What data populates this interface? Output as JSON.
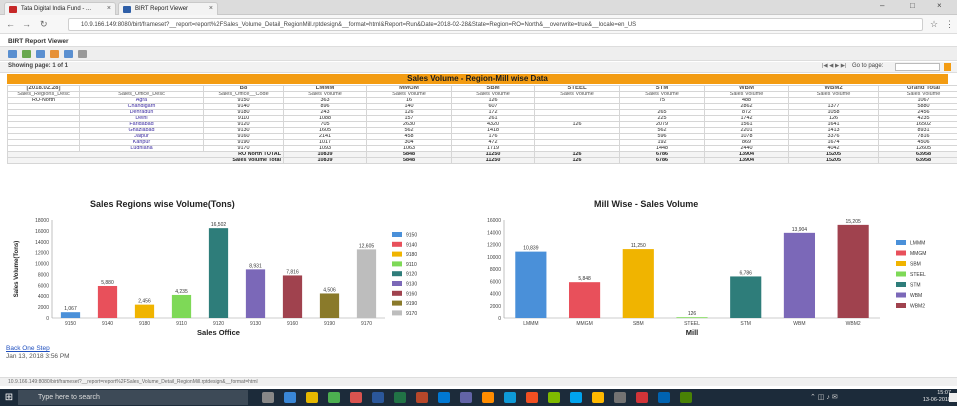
{
  "browser": {
    "tabs": [
      {
        "label": "Tata Digital India Fund - ..."
      },
      {
        "label": "BIRT Report Viewer"
      }
    ],
    "url": "10.9.166.149:8080/birt/frameset?__report=report%2FSales_Volume_Detail_RegionMill.rptdesign&__format=html&Report=Run&Date=2018-02-28&State=Region=RO=North&__overwrite=true&__locale=en_US"
  },
  "app": {
    "title": "BIRT Report Viewer",
    "pager": "Showing page: 1 of 1",
    "goto": "Go to page:"
  },
  "report": {
    "title": "Sales Volume - Region-Mill wise Data",
    "headers": [
      "[2018.02.28]",
      "",
      "",
      "B8",
      "LMMM",
      "MMGM",
      "SBM",
      "STEEL",
      "STM",
      "WBM",
      "WBM2",
      "Grand Total"
    ],
    "subheaders": [
      "Sales_Regions_Desc",
      "Sales_Office_Desc",
      "Sales_Office__Code",
      "Sales Volume",
      "Sales Volume",
      "Sales Volume",
      "Sales Volume",
      "Sales Volume",
      "Sales Volume",
      "Sales Volume",
      "Sales Volume"
    ],
    "rows": [
      [
        "RO-North",
        "Agra",
        "9150",
        "363",
        "16",
        "126",
        "",
        "75",
        "488",
        "",
        "1067"
      ],
      [
        "",
        "Chandigarh",
        "9140",
        "896",
        "140",
        "607",
        "",
        "",
        "2862",
        "1377",
        "5880"
      ],
      [
        "",
        "Dehradun",
        "9180",
        "243",
        "126",
        "172",
        "",
        "265",
        "872",
        "1058",
        "2456"
      ],
      [
        "",
        "Delhi",
        "9110",
        "1088",
        "157",
        "261",
        "",
        "225",
        "1742",
        "126",
        "4235"
      ],
      [
        "",
        "Faridabad",
        "9120",
        "705",
        "2630",
        "4320",
        "126",
        "2079",
        "1561",
        "1641",
        "16502"
      ],
      [
        "",
        "Ghaziabad",
        "9130",
        "1605",
        "562",
        "1418",
        "",
        "562",
        "2201",
        "1413",
        "8931"
      ],
      [
        "",
        "Jaipur",
        "9160",
        "2141",
        "458",
        "176",
        "",
        "596",
        "1078",
        "3376",
        "7816"
      ],
      [
        "",
        "Kanpur",
        "9190",
        "1017",
        "304",
        "472",
        "",
        "192",
        "869",
        "1674",
        "4506"
      ],
      [
        "",
        "Ludhiana",
        "9170",
        "1093",
        "1063",
        "1719",
        "",
        "1448",
        "2440",
        "4042",
        "12605"
      ]
    ],
    "total_row": {
      "label": "RO North TOTAL",
      "values": [
        "10839",
        "5848",
        "11250",
        "126",
        "6786",
        "13904",
        "15205",
        "63958"
      ]
    },
    "grand_row": {
      "label": "Sales Volume Total",
      "values": [
        "10839",
        "5848",
        "11250",
        "126",
        "6786",
        "13904",
        "15205",
        "63958"
      ]
    }
  },
  "chart_data": [
    {
      "type": "bar",
      "title": "Sales Regions wise Volume(Tons)",
      "xlabel": "Sales Office",
      "ylabel": "Sales Volume(Tons)",
      "categories": [
        "9150",
        "9140",
        "9180",
        "9110",
        "9120",
        "9130",
        "9160",
        "9190",
        "9170"
      ],
      "values": [
        1067,
        5880,
        2456,
        4235,
        16502,
        8931,
        7816,
        4506,
        12605
      ],
      "labels": [
        "1,067",
        "5,880",
        "2,456",
        "4,235",
        "16,502",
        "8,931",
        "7,816",
        "4,506",
        "12,605"
      ],
      "colors": [
        "#4a90d9",
        "#e8505b",
        "#f0b400",
        "#7ed957",
        "#2e7d7a",
        "#7b68b8",
        "#a0424e",
        "#8a7a2a",
        "#bdbdbd"
      ],
      "legend": [
        "9150",
        "9140",
        "9180",
        "9110",
        "9120",
        "9130",
        "9160",
        "9190",
        "9170"
      ],
      "ylim": [
        0,
        18000
      ],
      "yticks": [
        "0",
        "2000",
        "4000",
        "6000",
        "8000",
        "10000",
        "12000",
        "14000",
        "16000",
        "18000"
      ],
      "legend_position": "right",
      "grid": false
    },
    {
      "type": "bar",
      "title": "Mill Wise - Sales Volume",
      "xlabel": "Mill",
      "ylabel": "Sales Volume(Tons)",
      "categories": [
        "LMMM",
        "MMGM",
        "SBM",
        "STEEL",
        "STM",
        "WBM",
        "WBM2"
      ],
      "values": [
        10839,
        5848,
        11250,
        126,
        6786,
        13904,
        15205
      ],
      "labels": [
        "10,839",
        "5,848",
        "11,250",
        "126",
        "6,786",
        "13,904",
        "15,205"
      ],
      "colors": [
        "#4a90d9",
        "#e8505b",
        "#f0b400",
        "#7ed957",
        "#2e7d7a",
        "#7b68b8",
        "#a0424e"
      ],
      "legend": [
        "LMMM",
        "MMGM",
        "SBM",
        "STEEL",
        "STM",
        "WBM",
        "WBM2"
      ],
      "ylim": [
        0,
        16000
      ],
      "yticks": [
        "0",
        "2000",
        "4000",
        "6000",
        "8000",
        "10000",
        "12000",
        "14000",
        "16000"
      ],
      "legend_position": "right",
      "grid": false
    }
  ],
  "footer": {
    "back_link": "Back One Step",
    "date": "Jan 13, 2018 3:56 PM",
    "status_url": "10.9.166.149:8080/birt/frameset?__report=report%2FSales_Volume_Detail_RegionMill.rptdesign&__format=html"
  },
  "taskbar": {
    "search_placeholder": "Type here to search",
    "time": "15:07",
    "date": "13-06-2018"
  }
}
